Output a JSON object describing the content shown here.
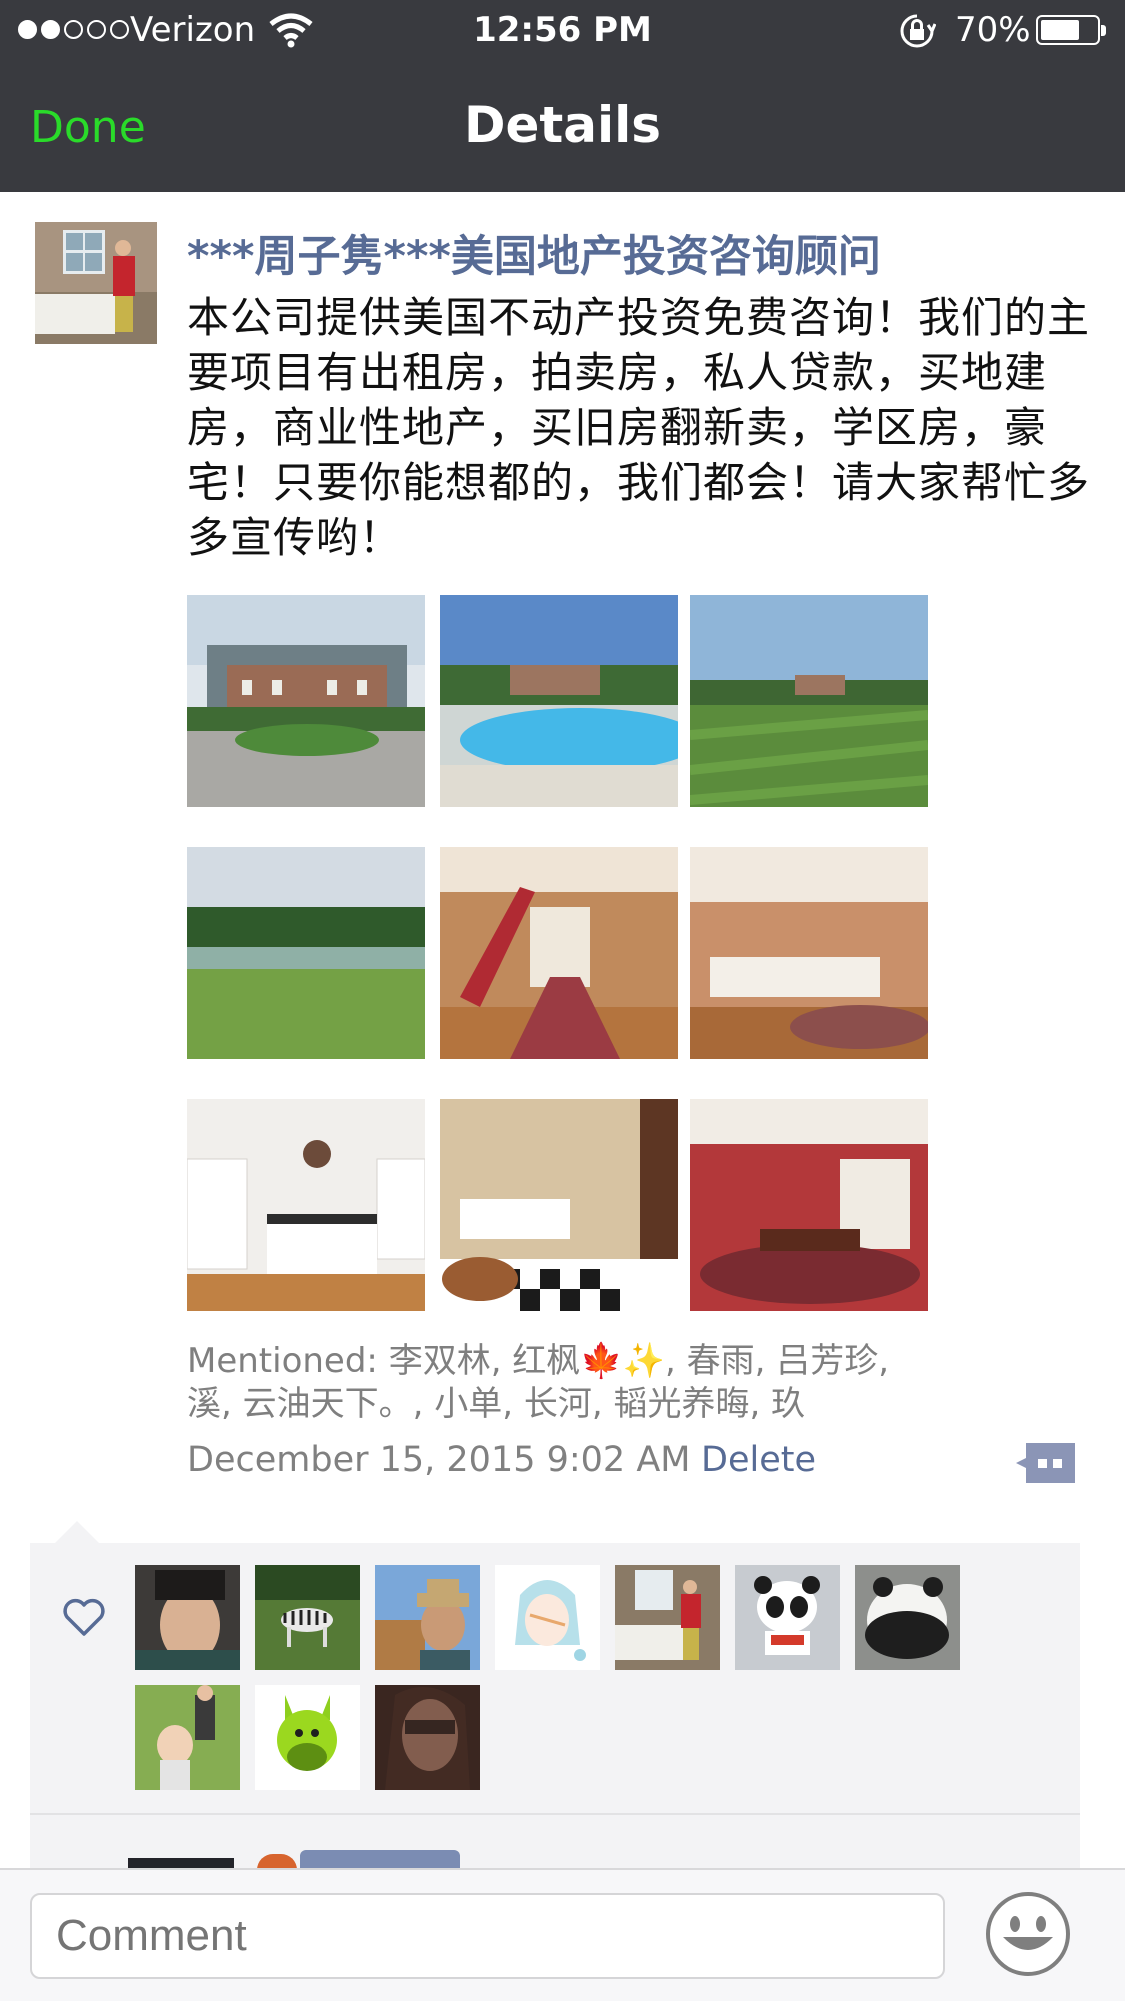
{
  "status_bar": {
    "carrier": "Verizon",
    "time": "12:56 PM",
    "battery_percent": "70%",
    "battery_level": 0.7,
    "signal_bars_filled": 2,
    "signal_bars_total": 5
  },
  "nav": {
    "done_label": "Done",
    "title": "Details",
    "accent_color": "#2adb2a"
  },
  "post": {
    "author": "***周子隽***美国地产投资咨询顾问",
    "text": "本公司提供美国不动产投资免费咨询！我们的主要项目有出租房，拍卖房，私人贷款，买地建房，商业性地产，买旧房翻新卖，学区房，豪宅！只要你能想都的，我们都会！请大家帮忙多多宣传哟！",
    "mentioned_line1": "Mentioned: 李双林, 红枫🍁✨, 春雨, 吕芳珍,",
    "mentioned_line2": "溪, 云油天下。, 小单, 长河, 韬光养晦, 玖",
    "date": "December 15, 2015 9:02 AM",
    "delete_label": "Delete",
    "link_color": "#576b95",
    "photos": [
      "house-front",
      "pool",
      "lawn",
      "tennis-court",
      "staircase",
      "upper-hall",
      "kitchen",
      "bathroom",
      "dining-room"
    ]
  },
  "likes": {
    "icon": "heart-icon",
    "likers": [
      "man-portrait",
      "zebra",
      "man-hat",
      "anime-girl",
      "man-bathroom",
      "panda-toy",
      "panda",
      "child-field",
      "green-donkey",
      "woman-sunglasses"
    ]
  },
  "comment_bar": {
    "placeholder": "Comment",
    "emoji_icon": "smiley-face-icon"
  }
}
